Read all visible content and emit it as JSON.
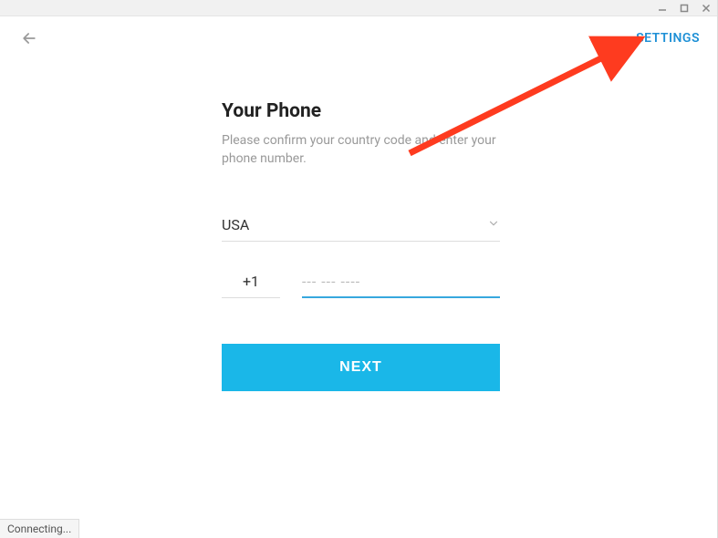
{
  "window": {
    "minimize": "—",
    "maximize": "☐",
    "close": "✕"
  },
  "topbar": {
    "settings_label": "SETTINGS"
  },
  "form": {
    "heading": "Your Phone",
    "subtext": "Please confirm your country code and enter your phone number.",
    "country_selected": "USA",
    "code_value": "+1",
    "phone_placeholder": "--- --- ----",
    "phone_value": "",
    "next_label": "NEXT"
  },
  "status": {
    "text": "Connecting..."
  },
  "colors": {
    "accent": "#1ab7e8",
    "link": "#1e90d6",
    "arrow": "#fe3b1f"
  }
}
